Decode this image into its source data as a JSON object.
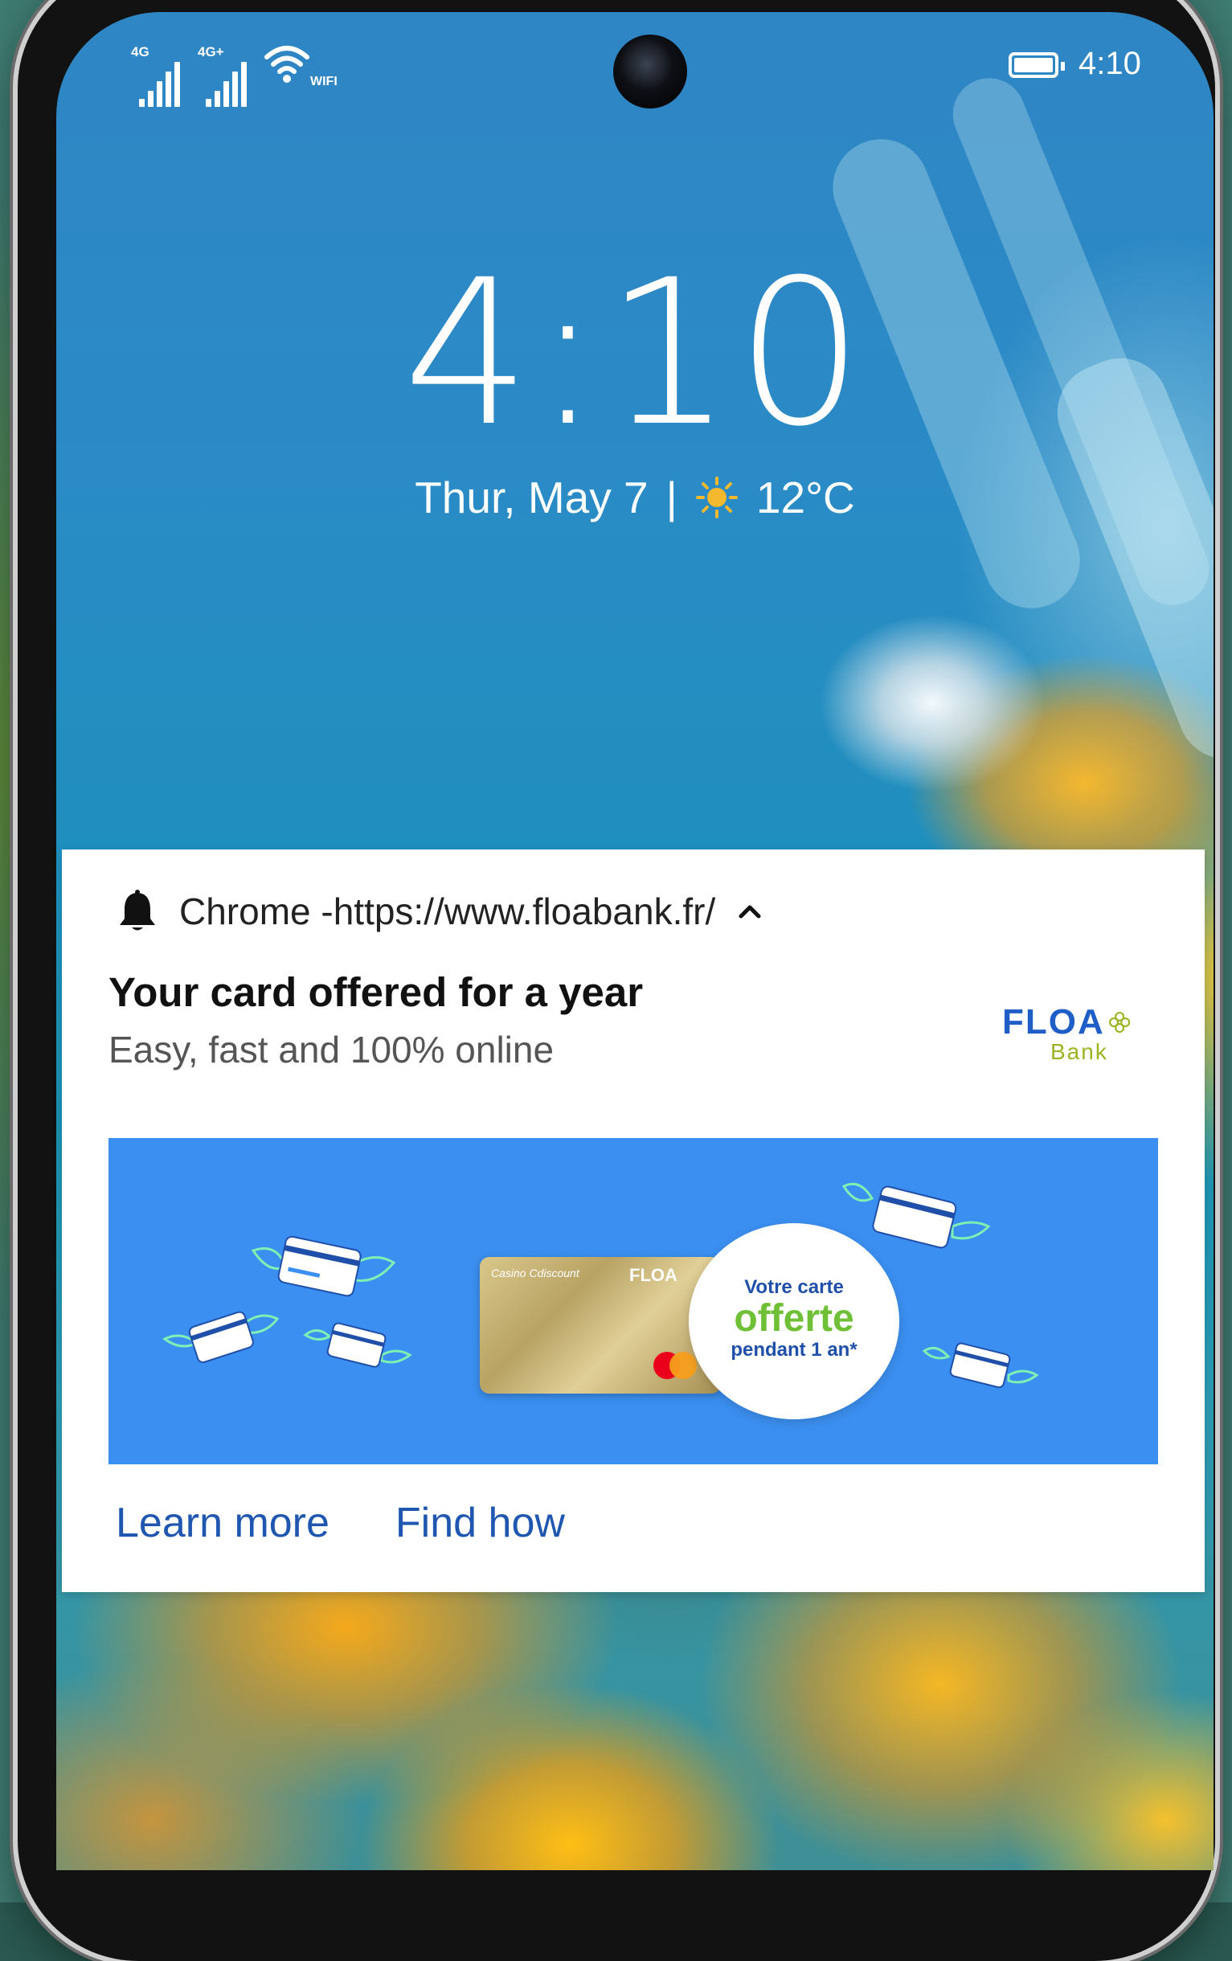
{
  "status_bar": {
    "sim1_network": "4G",
    "sim2_network": "4G+",
    "wifi_label": "WIFI",
    "time": "4:10",
    "icons": [
      "signal-icon",
      "signal-icon",
      "wifi-icon",
      "battery-icon"
    ]
  },
  "lock_screen": {
    "clock": "4:10",
    "date": "Thur, May 7",
    "separator": "|",
    "weather_icon": "sun-icon",
    "temperature": "12°C"
  },
  "notification": {
    "app_icon": "bell-icon",
    "source": "Chrome -https://www.floabank.fr/",
    "expand_icon": "chevron-up-icon",
    "title": "Your card offered for a year",
    "body": "Easy, fast and 100% online",
    "logo": {
      "name": "FLOA",
      "sub": "Bank"
    },
    "banner": {
      "card_brand": "Casino Cdiscount",
      "card_issuer": "FLOA",
      "badge_line1": "Votre carte",
      "badge_line2": "offerte",
      "badge_line3": "pendant 1 an*",
      "colors": {
        "background": "#3b8ff0",
        "badge_highlight": "#6fc036",
        "badge_text": "#1f4fa8"
      }
    },
    "actions": [
      "Learn more",
      "Find how"
    ],
    "action_color": "#1e56b0"
  }
}
